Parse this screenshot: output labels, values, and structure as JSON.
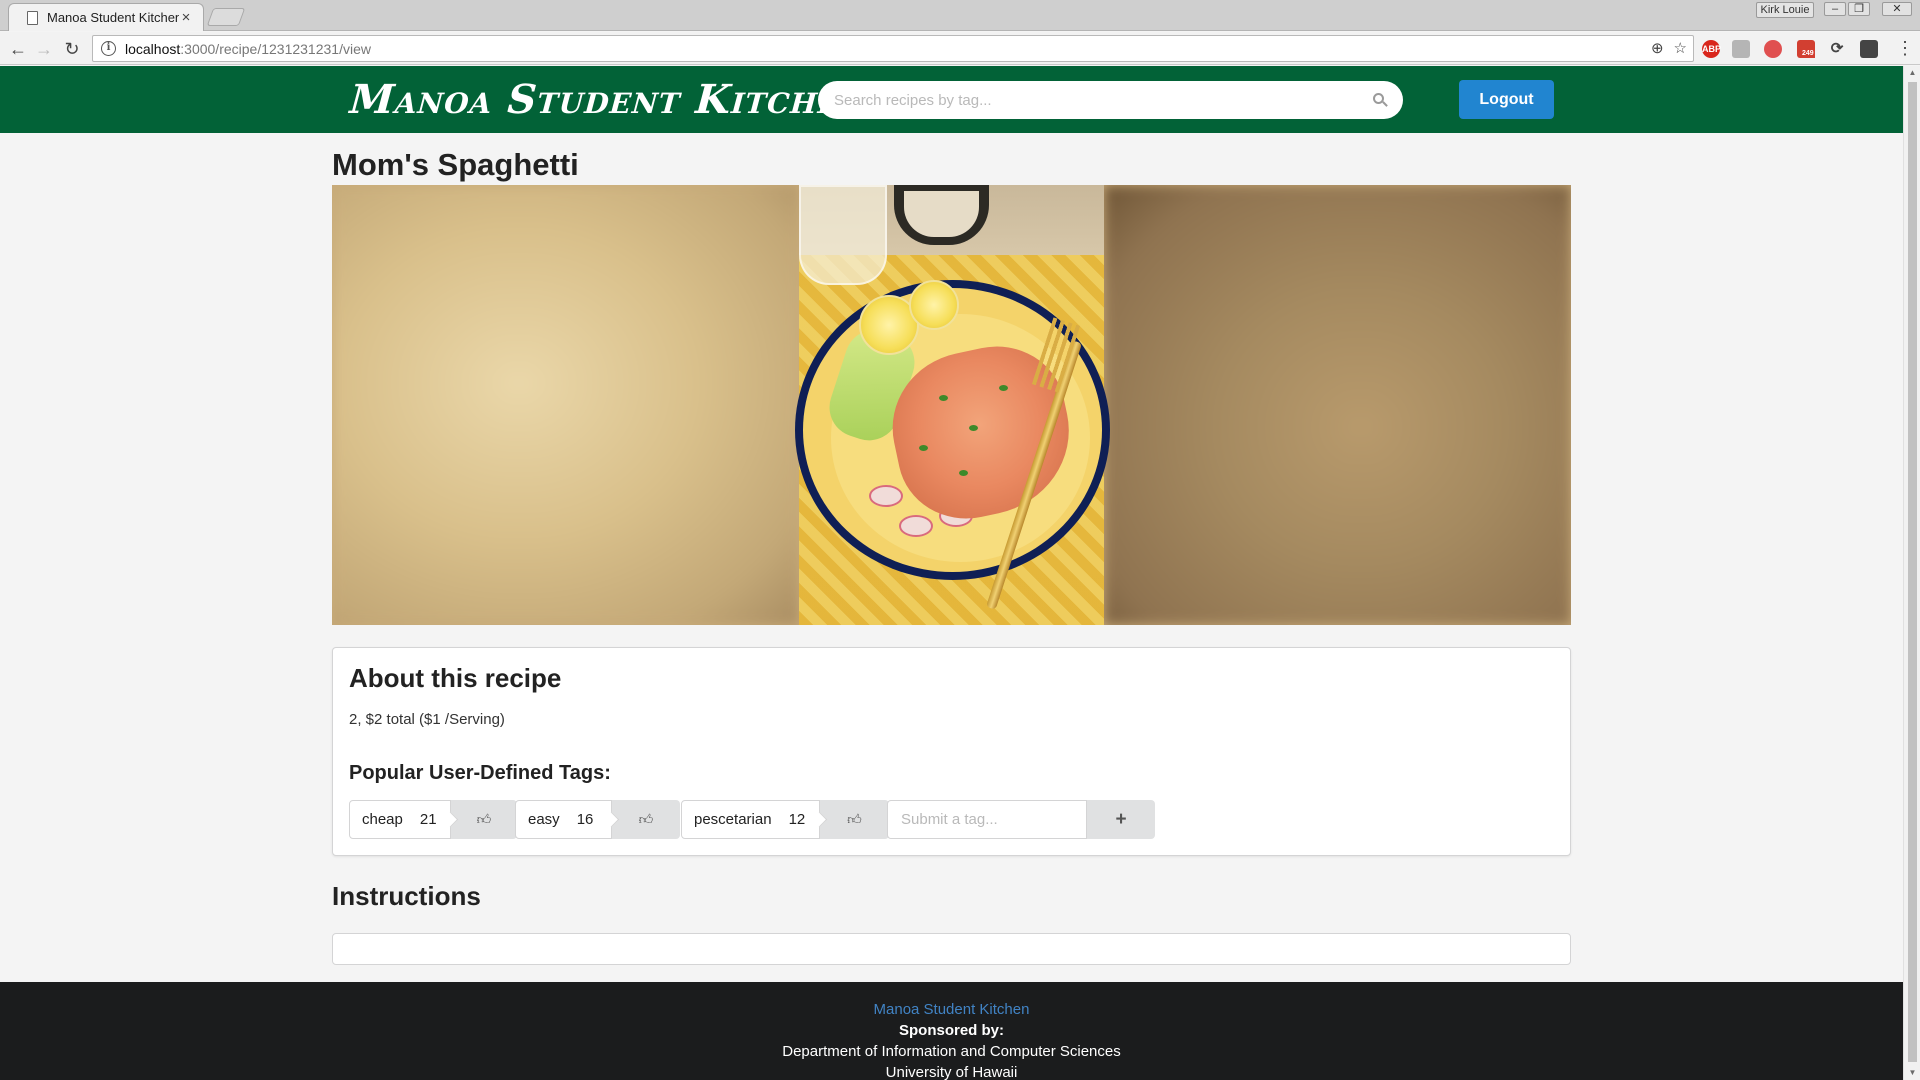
{
  "browser": {
    "tab_title": "Manoa Student Kitchen",
    "tab_close": "×",
    "profile_name": "Kirk Louie",
    "url_host": "localhost",
    "url_path": ":3000/recipe/1231231231/view",
    "gmail_badge": "249",
    "abp_label": "ABP"
  },
  "header": {
    "logo": "Manoa Student Kitchen",
    "search_placeholder": "Search recipes by tag...",
    "logout_label": "Logout",
    "brand_color": "#026237",
    "button_color": "#2185d0"
  },
  "recipe": {
    "title": "Mom's Spaghetti",
    "about_heading": "About this recipe",
    "summary": "2, $2 total ($1 /Serving)",
    "tags_heading": "Popular User-Defined Tags:",
    "tags": [
      {
        "name": "cheap",
        "count": "21",
        "icon": "thumbs-up-icon"
      },
      {
        "name": "easy",
        "count": "16",
        "icon": "thumbs-up-icon"
      },
      {
        "name": "pescetarian",
        "count": "12",
        "icon": "thumbs-up-icon"
      }
    ],
    "submit_tag_placeholder": "Submit a tag...",
    "submit_tag_button": "+",
    "instructions_heading": "Instructions"
  },
  "footer": {
    "site_link": "Manoa Student Kitchen",
    "sponsored": "Sponsored by:",
    "department": "Department of Information and Computer Sciences",
    "university": "University of Hawaii",
    "link_color": "#4183c4"
  }
}
